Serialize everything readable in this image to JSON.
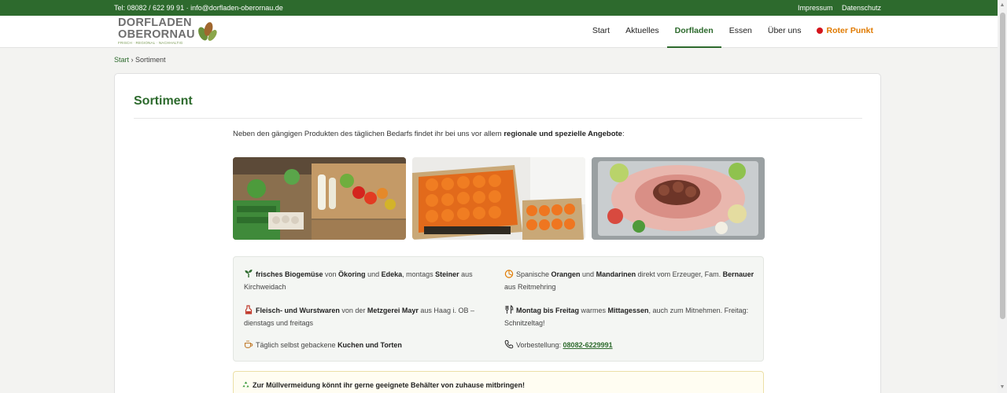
{
  "topbar": {
    "contact": "Tel: 08082 / 622 99 91 · info@dorfladen-oberornau.de",
    "impressum": "Impressum",
    "datenschutz": "Datenschutz"
  },
  "logo": {
    "line1": "DORFLADEN",
    "line2": "OBERORNAU",
    "tagline": "FRISCH · REGIONAL · NACHHALTIG"
  },
  "nav": {
    "items": [
      {
        "label": "Start"
      },
      {
        "label": "Aktuelles"
      },
      {
        "label": "Dorfladen",
        "active": true
      },
      {
        "label": "Essen"
      },
      {
        "label": "Über uns"
      },
      {
        "label": "Roter Punkt"
      }
    ]
  },
  "breadcrumb": {
    "home": "Start",
    "separator": "›",
    "current": "Sortiment"
  },
  "page": {
    "title": "Sortiment",
    "intro_prefix": "Neben den gängigen Produkten des täglichen Bedarfs findet ihr bei uns vor allem ",
    "intro_bold": "regionale und spezielle Angebote",
    "intro_suffix": ":"
  },
  "info": {
    "veg": {
      "b1": "frisches Biogemüse",
      "t1": " von ",
      "b2": "Ökoring",
      "t2": " und ",
      "b3": "Edeka",
      "t3": ", montags ",
      "b4": "Steiner",
      "t4": " aus Kirchweidach"
    },
    "fruit": {
      "t1": "Spanische ",
      "b1": "Orangen",
      "t2": " und ",
      "b2": "Mandarinen",
      "t3": " direkt vom Erzeuger, Fam. ",
      "b3": "Bernauer",
      "t4": " aus Reitmehring"
    },
    "meat": {
      "b1": "Fleisch- und Wurstwaren",
      "t1": " von der ",
      "b2": "Metzgerei Mayr",
      "t2": " aus Haag i. OB – dienstags und freitags"
    },
    "lunch": {
      "b1": "Montag bis Freitag",
      "t1": " warmes ",
      "b2": "Mittagessen",
      "t2": ", auch zum Mitnehmen. Freitag: Schnitzeltag!"
    },
    "cake": {
      "t1": "Täglich selbst gebackene ",
      "b1": "Kuchen und Torten"
    },
    "order": {
      "t1": "Vorbestellung: ",
      "phone": "08082-6229991"
    }
  },
  "notice": {
    "text": "Zur Müllvermeidung könnt ihr gerne geeignete Behälter von zuhause mitbringen!"
  },
  "colors": {
    "brand_green": "#2d6a2d",
    "accent_orange": "#e07a00",
    "red_point": "#d4151c"
  }
}
